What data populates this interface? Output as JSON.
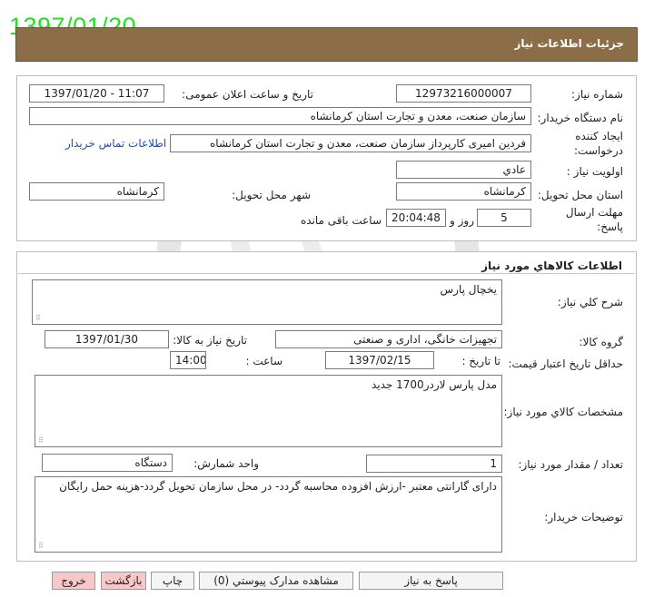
{
  "date_stamp": "1397/01/20",
  "header": {
    "title": "جزئیات اطلاعات نیاز"
  },
  "info": {
    "need_number_label": "شماره نیاز:",
    "need_number": "12973216000007",
    "announce_label": "تاریخ و ساعت اعلان عمومی:",
    "announce_value": "1397/01/20 - 11:07",
    "buyer_org_label": "نام دستگاه خریدار:",
    "buyer_org": "سازمان صنعت، معدن و تجارت استان کرمانشاه",
    "creator_label_1": "ایجاد کننده",
    "creator_label_2": "درخواست:",
    "creator": "فردین  امیری کارپرداز سازمان صنعت، معدن و تجارت استان کرمانشاه",
    "contact_link": "اطلاعات تماس خریدار",
    "priority_label": "اولویت نیاز :",
    "priority": "عادي",
    "province_label": "استان محل تحویل:",
    "province": "کرمانشاه",
    "city_label": "شهر محل تحویل:",
    "city": "کرمانشاه",
    "deadline_label_1": "مهلت ارسال",
    "deadline_label_2": "پاسخ:",
    "days": "5",
    "days_unit": "روز و",
    "time_left": "20:04:48",
    "time_left_label": "ساعت باقی مانده"
  },
  "goods": {
    "section_title": "اطلاعات کالاهاي مورد نياز",
    "general_desc_label": "شرح کلي نياز:",
    "general_desc": "یخچال پارس",
    "group_label": "گروه کالا:",
    "group": "تجهیزات خانگی، اداری و صنعتی",
    "need_date_label": "تاریخ نیاز به کالا:",
    "need_date": "1397/01/30",
    "validity_label": "حداقل تاریخ اعتبار قیمت:",
    "until_date_label": "تا تاریخ :",
    "until_date": "1397/02/15",
    "time_label": "ساعت :",
    "time": "14:00",
    "specs_label": "مشخصات کالاي مورد نياز:",
    "specs": "مدل پارس لاردر1700 جدید",
    "qty_label": "تعداد / مقدار مورد نیاز:",
    "qty": "1",
    "unit_label": "واحد شمارش:",
    "unit": "دستگاه",
    "buyer_notes_label": "توضیحات خریدار:",
    "buyer_notes": "دارای گارانتی معتبر -ارزش افزوده محاسبه گردد- در محل سازمان تحویل گردد-هزینه حمل رایگان"
  },
  "buttons": {
    "reply": "پاسخ به نیاز",
    "attachments": "مشاهده مدارک پیوستي (0)",
    "print": "چاپ",
    "back": "بازگشت",
    "exit": "خروج"
  },
  "colors": {
    "header_bg": "#8b6e47",
    "date_stamp": "#22e022",
    "link": "#1a4fb5",
    "exit_btn": "#f7c8c8"
  }
}
